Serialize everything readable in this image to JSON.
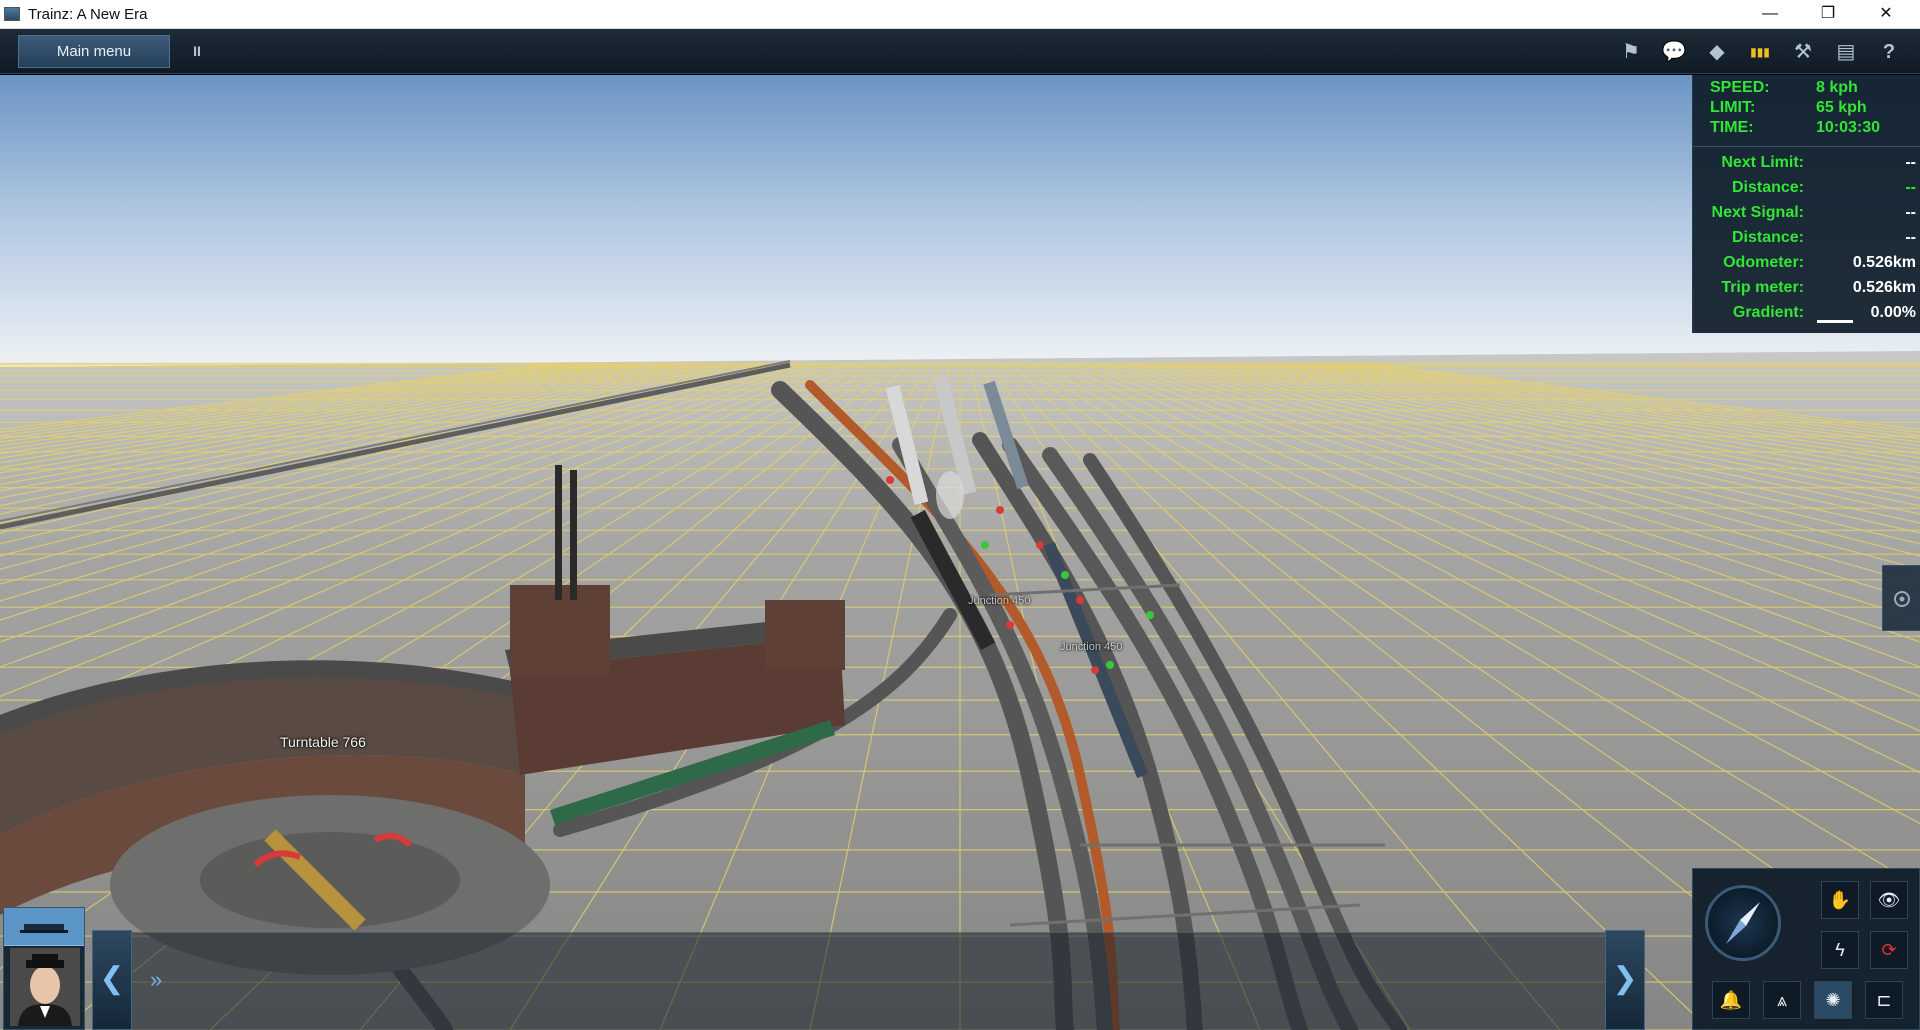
{
  "window": {
    "title": "Trainz: A New Era",
    "minimize_icon": "—",
    "maximize_icon": "❐",
    "close_icon": "✕"
  },
  "toolbar": {
    "main_menu_label": "Main menu",
    "pause_label": "II",
    "icons": {
      "flag": "⚑",
      "chat": "💬",
      "layers": "◆",
      "signals": "▮▮▮",
      "tools": "⚒",
      "film": "▤",
      "help": "?"
    }
  },
  "hud": {
    "speed_label": "SPEED:",
    "speed_value": "8 kph",
    "limit_label": "LIMIT:",
    "limit_value": "65 kph",
    "time_label": "TIME:",
    "time_value": "10:03:30",
    "next_limit_label": "Next Limit:",
    "next_limit_value": "--",
    "distance1_label": "Distance:",
    "distance1_value": "--",
    "next_signal_label": "Next Signal:",
    "next_signal_value": "--",
    "distance2_label": "Distance:",
    "distance2_value": "--",
    "odometer_label": "Odometer:",
    "odometer_value": "0.526km",
    "trip_label": "Trip meter:",
    "trip_value": "0.526km",
    "gradient_label": "Gradient:",
    "gradient_value": "0.00%"
  },
  "scene": {
    "turntable_label": "Turntable 766",
    "junction_label_1": "Junction 450",
    "junction_label_2": "Junction 450"
  },
  "bottom": {
    "nav_left": "❮",
    "nav_right": "❯",
    "expand": "»"
  },
  "control_panel": {
    "icons": [
      "✋",
      "👁",
      "ϟ",
      "⟳",
      "🔔",
      "⩓",
      "✺",
      "⊏"
    ]
  },
  "colors": {
    "hud_green": "#31e635",
    "hud_bg": "#0e1c28",
    "toolbar_bg": "#16232f",
    "grid_line": "#e6d26a",
    "ground": "#8d8d8b",
    "sky_top": "#6f98c4",
    "signal_red": "#d83a3a"
  }
}
